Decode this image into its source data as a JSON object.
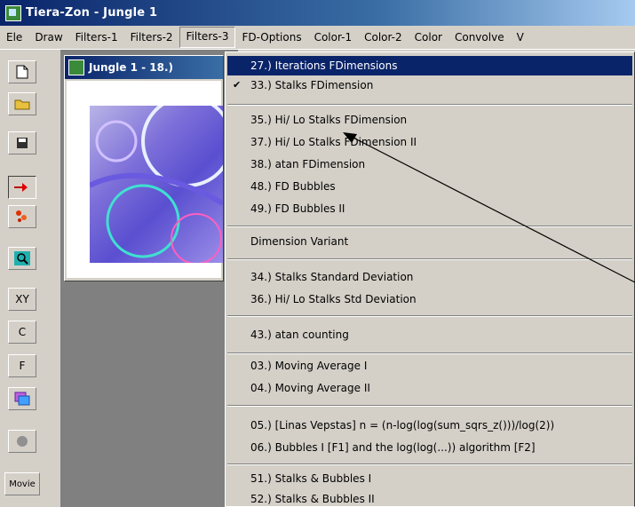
{
  "window": {
    "title": "Tiera-Zon - Jungle 1"
  },
  "menubar": {
    "items": [
      "Ele",
      "Draw",
      "Filters-1",
      "Filters-2",
      "Filters-3",
      "FD-Options",
      "Color-1",
      "Color-2",
      "Color",
      "Convolve",
      "V"
    ],
    "active": "Filters-3"
  },
  "toolbar": {
    "buttons": [
      "new",
      "open",
      "save",
      "tool-red",
      "tool-scatter",
      "zoom",
      "xy",
      "C",
      "F",
      "layers",
      "circle",
      "Movie"
    ],
    "labels": {
      "xy": "XY",
      "c": "C",
      "f": "F",
      "movie": "Movie"
    }
  },
  "child_window": {
    "title": "Jungle 1 - 18.)"
  },
  "filters3_menu": {
    "items": [
      {
        "label": "27.) Iterations FDimensions",
        "highlighted": true,
        "checked": false
      },
      {
        "label": "33.) Stalks FDimension",
        "highlighted": false,
        "checked": true
      },
      {
        "label": "35.) Hi/ Lo Stalks FDimension"
      },
      {
        "label": "37.) Hi/ Lo Stalks FDimension II"
      },
      {
        "label": "38.) atan FDimension"
      },
      {
        "label": "48.) FD Bubbles"
      },
      {
        "label": "49.) FD Bubbles II"
      },
      {
        "label": "Dimension Variant"
      },
      {
        "label": "34.) Stalks Standard Deviation"
      },
      {
        "label": "36.) Hi/ Lo Stalks Std Deviation"
      },
      {
        "label": "43.) atan counting"
      },
      {
        "label": "03.) Moving Average I"
      },
      {
        "label": "04.) Moving Average II"
      },
      {
        "label": "05.) [Linas Vepstas] n = (n-log(log(sum_sqrs_z()))/log(2))"
      },
      {
        "label": "06.) Bubbles I [F1] and the log(log(...)) algorithm [F2]"
      },
      {
        "label": "51.) Stalks & Bubbles I"
      },
      {
        "label": "52.) Stalks & Bubbles II"
      }
    ],
    "check_mark": "✔"
  }
}
